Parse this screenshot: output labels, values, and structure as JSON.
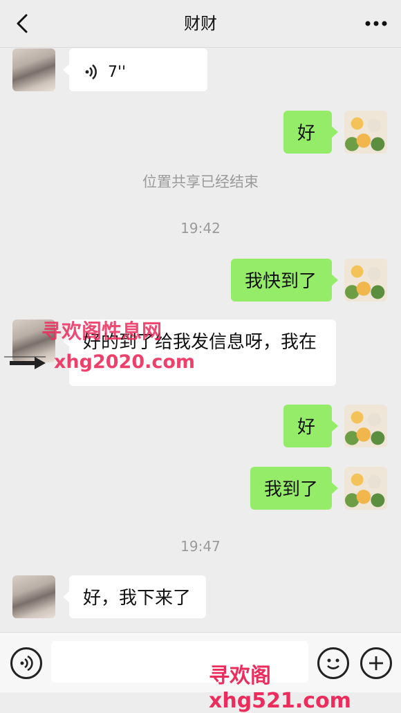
{
  "header": {
    "title": "财财",
    "back_icon": "chevron-left-icon",
    "more_icon": "more-dots-icon"
  },
  "messages": [
    {
      "side": "left",
      "type": "voice",
      "text": "7''"
    },
    {
      "side": "right",
      "text": "好"
    },
    {
      "type": "system",
      "text": "位置共享已经结束"
    },
    {
      "type": "time",
      "text": "19:42"
    },
    {
      "side": "right",
      "text": "我快到了"
    },
    {
      "side": "left",
      "text": "好的到了给我发信息呀，我在"
    },
    {
      "side": "right",
      "text": "好"
    },
    {
      "side": "right",
      "text": "我到了"
    },
    {
      "type": "time",
      "text": "19:47"
    },
    {
      "side": "left",
      "text": "好，我下来了"
    }
  ],
  "watermarks": {
    "top_cn": "寻欢阁性息网",
    "top_url": "xhg2020.com",
    "bottom": "寻欢阁xhg521.com"
  },
  "footer": {
    "voice_icon": "voice-icon",
    "emoji_icon": "emoji-icon",
    "add_icon": "plus-icon",
    "input_value": ""
  },
  "colors": {
    "background": "#ededed",
    "bubble_mine": "#95ec69",
    "bubble_theirs": "#ffffff",
    "watermark": "#ec2c5c"
  }
}
